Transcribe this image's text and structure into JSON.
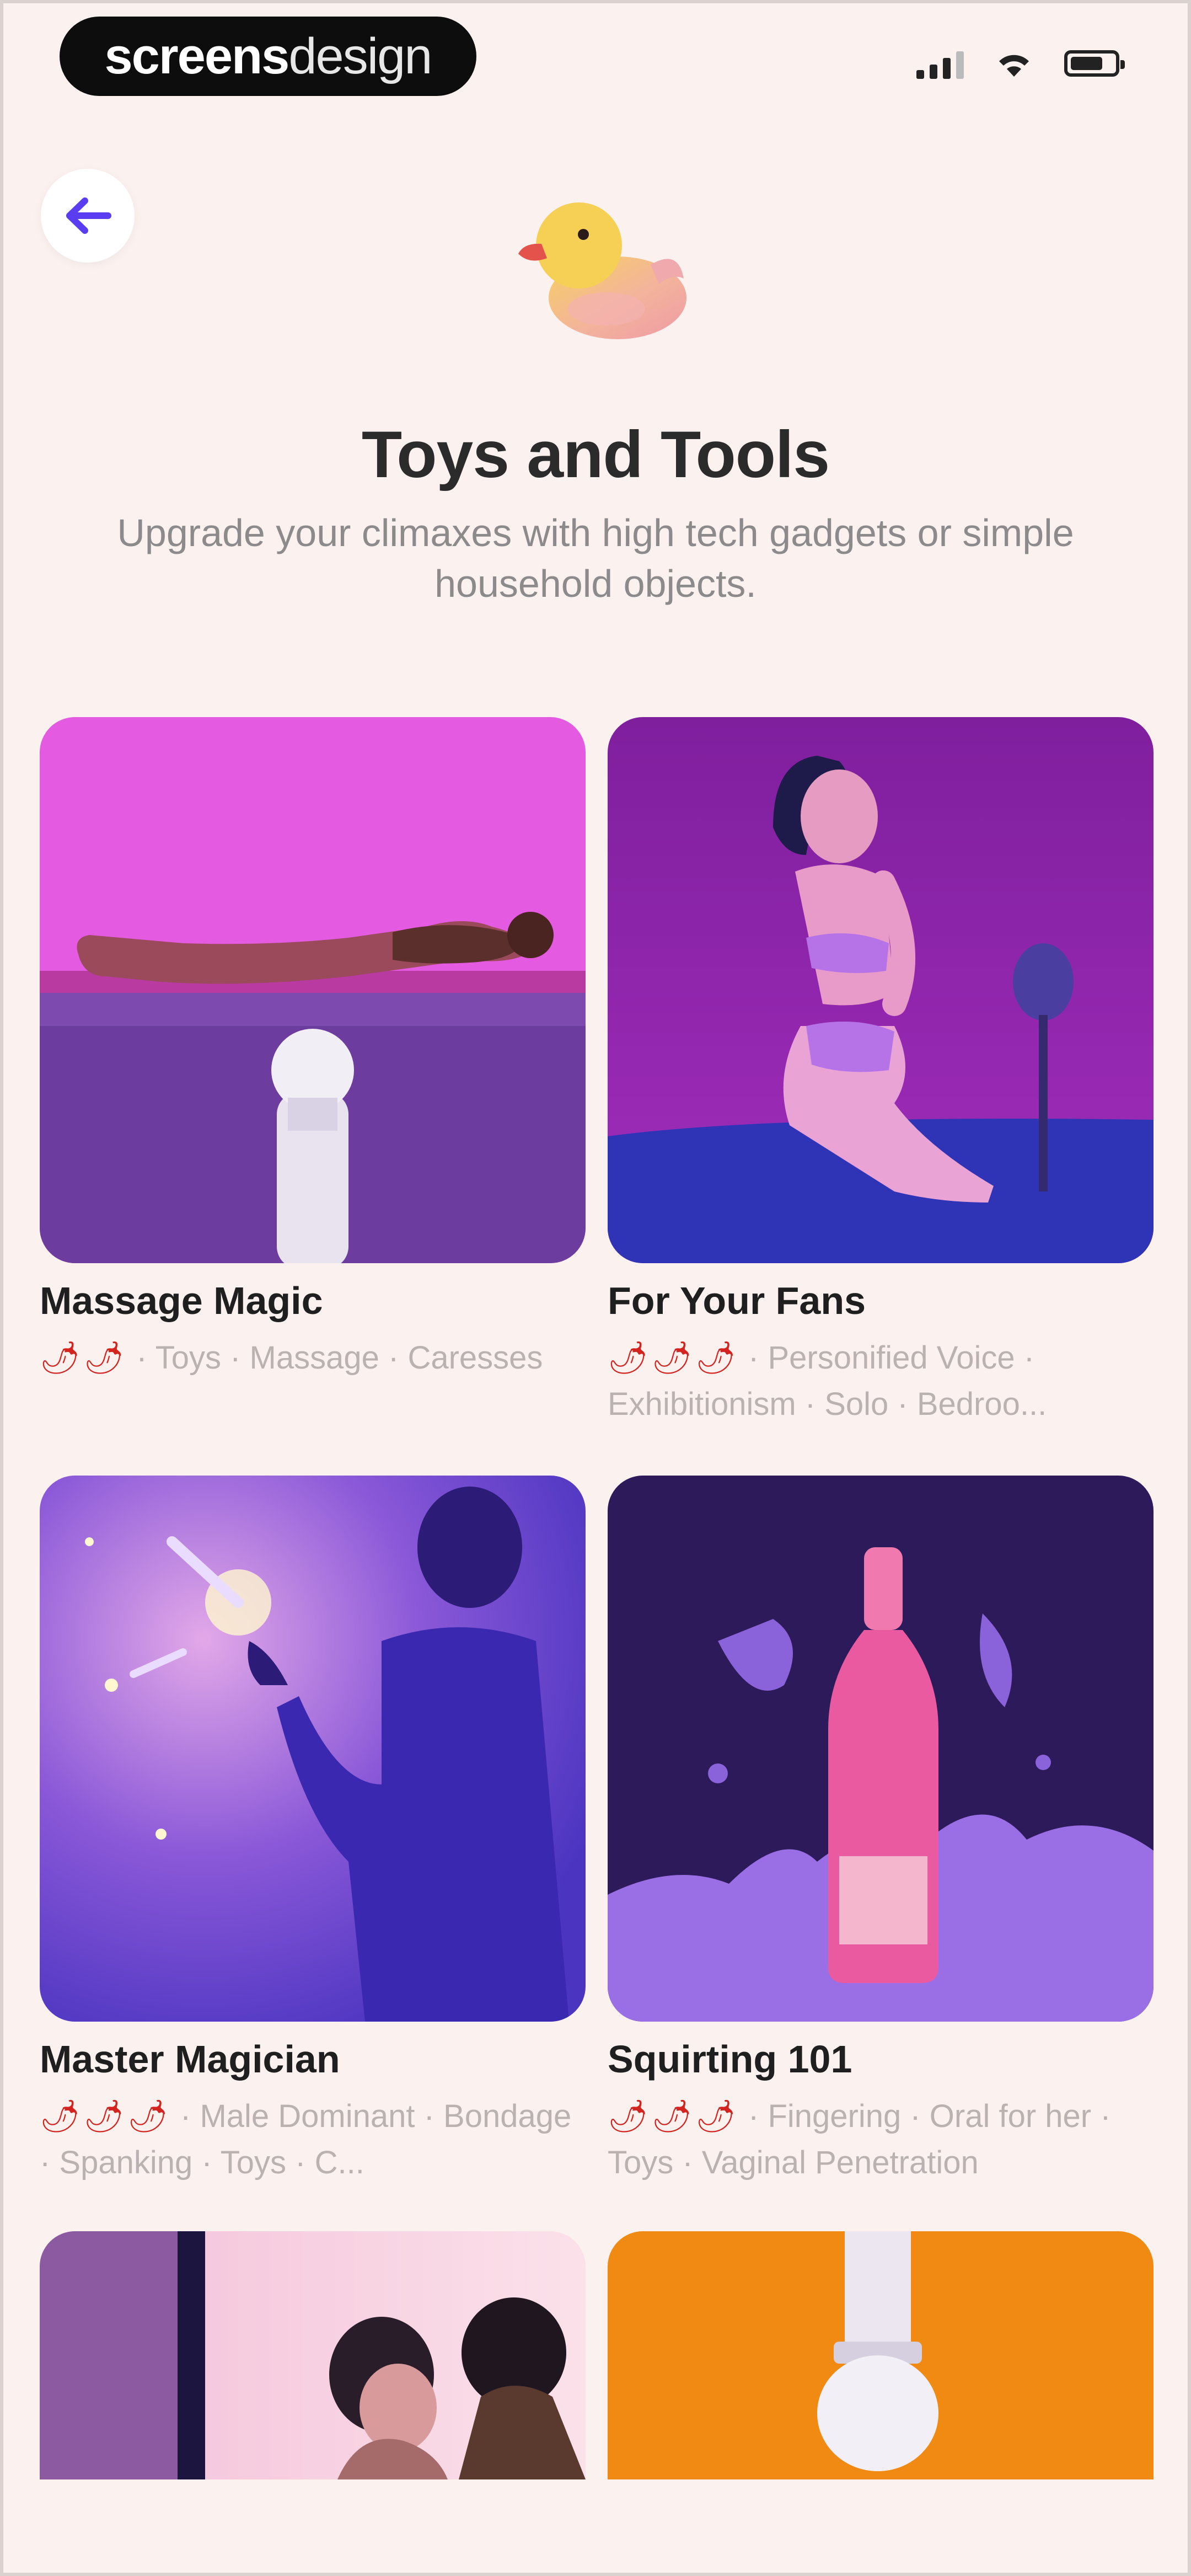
{
  "status_bar": {
    "brand_bold": "screens",
    "brand_light": "design"
  },
  "header": {
    "back_icon": "arrow-left-icon",
    "emoji_icon": "rubber-duck-icon",
    "title": "Toys and Tools",
    "subtitle": "Upgrade your climaxes with high tech gadgets or simple household objects."
  },
  "cards": [
    {
      "title": "Massage Magic",
      "peppers": "🌶🌶",
      "tags": " · Toys · Massage · Caresses"
    },
    {
      "title": "For Your Fans",
      "peppers": "🌶🌶🌶",
      "tags": " · Personified Voice · Exhibitionism · Solo · Bedroo..."
    },
    {
      "title": "Master Magician",
      "peppers": "🌶🌶🌶",
      "tags": " · Male Dominant · Bondage · Spanking · Toys · C..."
    },
    {
      "title": "Squirting 101",
      "peppers": "🌶🌶🌶",
      "tags": " · Fingering · Oral for her · Toys · Vaginal Penetration"
    }
  ],
  "colors": {
    "background": "#fbf1ef",
    "accent": "#5a3df0",
    "pepper": "#d3241f"
  }
}
